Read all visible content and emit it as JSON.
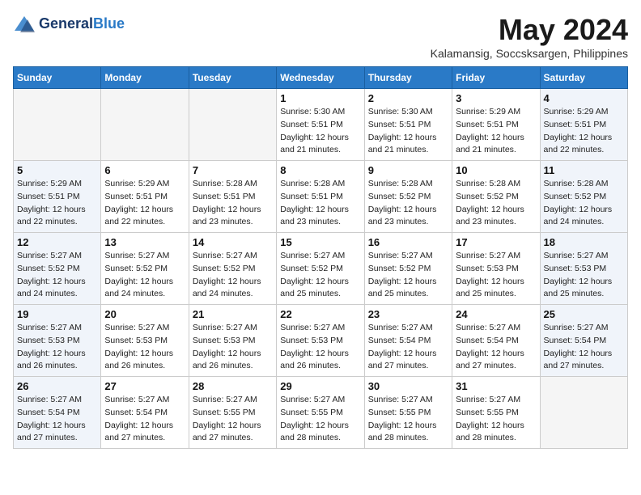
{
  "header": {
    "logo_line1": "General",
    "logo_line2": "Blue",
    "month": "May 2024",
    "location": "Kalamansig, Soccsksargen, Philippines"
  },
  "columns": [
    "Sunday",
    "Monday",
    "Tuesday",
    "Wednesday",
    "Thursday",
    "Friday",
    "Saturday"
  ],
  "weeks": [
    [
      {
        "day": "",
        "info": ""
      },
      {
        "day": "",
        "info": ""
      },
      {
        "day": "",
        "info": ""
      },
      {
        "day": "1",
        "info": "Sunrise: 5:30 AM\nSunset: 5:51 PM\nDaylight: 12 hours\nand 21 minutes."
      },
      {
        "day": "2",
        "info": "Sunrise: 5:30 AM\nSunset: 5:51 PM\nDaylight: 12 hours\nand 21 minutes."
      },
      {
        "day": "3",
        "info": "Sunrise: 5:29 AM\nSunset: 5:51 PM\nDaylight: 12 hours\nand 21 minutes."
      },
      {
        "day": "4",
        "info": "Sunrise: 5:29 AM\nSunset: 5:51 PM\nDaylight: 12 hours\nand 22 minutes."
      }
    ],
    [
      {
        "day": "5",
        "info": "Sunrise: 5:29 AM\nSunset: 5:51 PM\nDaylight: 12 hours\nand 22 minutes."
      },
      {
        "day": "6",
        "info": "Sunrise: 5:29 AM\nSunset: 5:51 PM\nDaylight: 12 hours\nand 22 minutes."
      },
      {
        "day": "7",
        "info": "Sunrise: 5:28 AM\nSunset: 5:51 PM\nDaylight: 12 hours\nand 23 minutes."
      },
      {
        "day": "8",
        "info": "Sunrise: 5:28 AM\nSunset: 5:51 PM\nDaylight: 12 hours\nand 23 minutes."
      },
      {
        "day": "9",
        "info": "Sunrise: 5:28 AM\nSunset: 5:52 PM\nDaylight: 12 hours\nand 23 minutes."
      },
      {
        "day": "10",
        "info": "Sunrise: 5:28 AM\nSunset: 5:52 PM\nDaylight: 12 hours\nand 23 minutes."
      },
      {
        "day": "11",
        "info": "Sunrise: 5:28 AM\nSunset: 5:52 PM\nDaylight: 12 hours\nand 24 minutes."
      }
    ],
    [
      {
        "day": "12",
        "info": "Sunrise: 5:27 AM\nSunset: 5:52 PM\nDaylight: 12 hours\nand 24 minutes."
      },
      {
        "day": "13",
        "info": "Sunrise: 5:27 AM\nSunset: 5:52 PM\nDaylight: 12 hours\nand 24 minutes."
      },
      {
        "day": "14",
        "info": "Sunrise: 5:27 AM\nSunset: 5:52 PM\nDaylight: 12 hours\nand 24 minutes."
      },
      {
        "day": "15",
        "info": "Sunrise: 5:27 AM\nSunset: 5:52 PM\nDaylight: 12 hours\nand 25 minutes."
      },
      {
        "day": "16",
        "info": "Sunrise: 5:27 AM\nSunset: 5:52 PM\nDaylight: 12 hours\nand 25 minutes."
      },
      {
        "day": "17",
        "info": "Sunrise: 5:27 AM\nSunset: 5:53 PM\nDaylight: 12 hours\nand 25 minutes."
      },
      {
        "day": "18",
        "info": "Sunrise: 5:27 AM\nSunset: 5:53 PM\nDaylight: 12 hours\nand 25 minutes."
      }
    ],
    [
      {
        "day": "19",
        "info": "Sunrise: 5:27 AM\nSunset: 5:53 PM\nDaylight: 12 hours\nand 26 minutes."
      },
      {
        "day": "20",
        "info": "Sunrise: 5:27 AM\nSunset: 5:53 PM\nDaylight: 12 hours\nand 26 minutes."
      },
      {
        "day": "21",
        "info": "Sunrise: 5:27 AM\nSunset: 5:53 PM\nDaylight: 12 hours\nand 26 minutes."
      },
      {
        "day": "22",
        "info": "Sunrise: 5:27 AM\nSunset: 5:53 PM\nDaylight: 12 hours\nand 26 minutes."
      },
      {
        "day": "23",
        "info": "Sunrise: 5:27 AM\nSunset: 5:54 PM\nDaylight: 12 hours\nand 27 minutes."
      },
      {
        "day": "24",
        "info": "Sunrise: 5:27 AM\nSunset: 5:54 PM\nDaylight: 12 hours\nand 27 minutes."
      },
      {
        "day": "25",
        "info": "Sunrise: 5:27 AM\nSunset: 5:54 PM\nDaylight: 12 hours\nand 27 minutes."
      }
    ],
    [
      {
        "day": "26",
        "info": "Sunrise: 5:27 AM\nSunset: 5:54 PM\nDaylight: 12 hours\nand 27 minutes."
      },
      {
        "day": "27",
        "info": "Sunrise: 5:27 AM\nSunset: 5:54 PM\nDaylight: 12 hours\nand 27 minutes."
      },
      {
        "day": "28",
        "info": "Sunrise: 5:27 AM\nSunset: 5:55 PM\nDaylight: 12 hours\nand 27 minutes."
      },
      {
        "day": "29",
        "info": "Sunrise: 5:27 AM\nSunset: 5:55 PM\nDaylight: 12 hours\nand 28 minutes."
      },
      {
        "day": "30",
        "info": "Sunrise: 5:27 AM\nSunset: 5:55 PM\nDaylight: 12 hours\nand 28 minutes."
      },
      {
        "day": "31",
        "info": "Sunrise: 5:27 AM\nSunset: 5:55 PM\nDaylight: 12 hours\nand 28 minutes."
      },
      {
        "day": "",
        "info": ""
      }
    ]
  ]
}
